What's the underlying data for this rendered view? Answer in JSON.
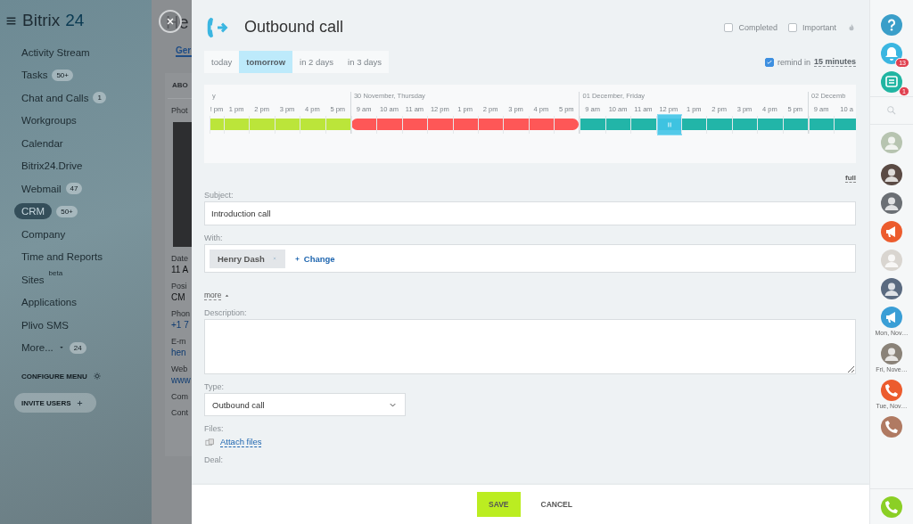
{
  "sidebar": {
    "logo": {
      "name": "Bitrix",
      "number": "24"
    },
    "items": [
      {
        "label": "Activity Stream",
        "selected": false
      },
      {
        "label": "Tasks",
        "counter": "50+",
        "selected": false
      },
      {
        "label": "Chat and Calls",
        "counter": "1",
        "selected": false
      },
      {
        "label": "Workgroups",
        "selected": false
      },
      {
        "label": "Calendar",
        "selected": false
      },
      {
        "label": "Bitrix24.Drive",
        "selected": false
      },
      {
        "label": "Webmail",
        "counter": "47",
        "selected": false
      },
      {
        "label": "CRM",
        "counter": "50+",
        "selected": true
      },
      {
        "label": "Company",
        "selected": false
      },
      {
        "label": "Time and Reports",
        "selected": false
      },
      {
        "label": "Sites",
        "tag": "beta",
        "selected": false
      },
      {
        "label": "Applications",
        "selected": false
      },
      {
        "label": "Plivo SMS",
        "selected": false
      },
      {
        "label": "More...",
        "caret": true,
        "counter": "24",
        "selected": false
      }
    ],
    "configure": "CONFIGURE MENU",
    "invite": "INVITE USERS"
  },
  "contact_card": {
    "title": "He",
    "tab": "Ger",
    "section": "ABO",
    "fields": [
      {
        "label": "Phot",
        "kind": "photo"
      },
      {
        "label": "Date",
        "value": "11 A",
        "kind": "text"
      },
      {
        "label": "Posi",
        "value": "CM",
        "kind": "text"
      },
      {
        "label": "Phon",
        "value": "+1 7",
        "kind": "phone"
      },
      {
        "label": "E-m",
        "value": "hen",
        "kind": "link"
      },
      {
        "label": "Web",
        "value": "www",
        "kind": "link"
      },
      {
        "label": "Com",
        "kind": "text"
      },
      {
        "label": "Cont",
        "kind": "text"
      }
    ]
  },
  "activity": {
    "title": "Outbound call",
    "flags": [
      {
        "label": "Completed",
        "checked": false
      },
      {
        "label": "Important",
        "checked": false
      }
    ],
    "tabs": [
      {
        "label": "today",
        "selected": false
      },
      {
        "label": "tomorrow",
        "selected": true
      },
      {
        "label": "in 2 days",
        "selected": false
      },
      {
        "label": "in 3 days",
        "selected": false
      }
    ],
    "reminder": {
      "checked": true,
      "label": "remind in",
      "value": "15 minutes"
    },
    "timeline": {
      "days": [
        {
          "label": "y",
          "color": "#bbe53a",
          "hours": [
            {
              "label": "! pm",
              "selected": false
            },
            {
              "label": "1 pm",
              "selected": false
            },
            {
              "label": "2 pm",
              "selected": false
            },
            {
              "label": "3 pm",
              "selected": false
            },
            {
              "label": "4 pm",
              "selected": false
            },
            {
              "label": "5 pm",
              "selected": false
            }
          ]
        },
        {
          "label": "30 November, Thursday",
          "color": "#fe5757",
          "hours": [
            {
              "label": "9 am",
              "selected": false
            },
            {
              "label": "10 am",
              "selected": false
            },
            {
              "label": "11 am",
              "selected": false
            },
            {
              "label": "12 pm",
              "selected": false
            },
            {
              "label": "1 pm",
              "selected": false
            },
            {
              "label": "2 pm",
              "selected": false
            },
            {
              "label": "3 pm",
              "selected": false
            },
            {
              "label": "4 pm",
              "selected": false
            },
            {
              "label": "5 pm",
              "selected": false
            }
          ]
        },
        {
          "label": "01 December, Friday",
          "color": "#22b5a8",
          "hours": [
            {
              "label": "9 am",
              "selected": false
            },
            {
              "label": "10 am",
              "selected": false
            },
            {
              "label": "11 am",
              "selected": false
            },
            {
              "label": "12 pm",
              "selected": true
            },
            {
              "label": "1 pm",
              "selected": false
            },
            {
              "label": "2 pm",
              "selected": false
            },
            {
              "label": "3 pm",
              "selected": false
            },
            {
              "label": "4 pm",
              "selected": false
            },
            {
              "label": "5 pm",
              "selected": false
            }
          ]
        },
        {
          "label": "02 Decemb",
          "color": "#22b5a8",
          "hours": [
            {
              "label": "9 am",
              "selected": false
            },
            {
              "label": "10 a",
              "selected": false
            }
          ]
        }
      ],
      "full_link": "full"
    },
    "subject": {
      "label": "Subject:",
      "value": "Introduction call"
    },
    "with": {
      "label": "With:",
      "contact": "Henry Dash",
      "change": "Change"
    },
    "more": "more",
    "description": {
      "label": "Description:"
    },
    "type": {
      "label": "Type:",
      "value": "Outbound call"
    },
    "files": {
      "label": "Files:",
      "link": "Attach files"
    },
    "deal": {
      "label": "Deal:"
    },
    "buttons": [
      {
        "label": "SAVE",
        "kind": "primary"
      },
      {
        "label": "CANCEL",
        "kind": "link"
      }
    ]
  },
  "right_bar": {
    "items": [
      {
        "kind": "help",
        "color": "#3a9ec9"
      },
      {
        "kind": "bell",
        "color": "#3bb6e1",
        "badge": "13"
      },
      {
        "kind": "chat",
        "color": "#21b5a2",
        "badge": "1"
      },
      {
        "kind": "search"
      },
      {
        "kind": "avatar",
        "color": "#b7c4b0"
      },
      {
        "kind": "avatar",
        "color": "#5a4a44"
      },
      {
        "kind": "avatar",
        "color": "#6b6f74"
      },
      {
        "kind": "megaphone",
        "color": "#ec5c2e"
      },
      {
        "kind": "avatar",
        "color": "#d9d5d0"
      },
      {
        "kind": "avatar",
        "color": "#5a6a80"
      },
      {
        "kind": "megaphone",
        "color": "#3a9ed6",
        "caption": "Mon, Nov…"
      },
      {
        "kind": "avatar",
        "color": "#8a8278",
        "caption": "Fri, Nove…"
      },
      {
        "kind": "phone",
        "color": "#ec5c2e",
        "caption": "Tue, Nov…"
      },
      {
        "kind": "phone",
        "color": "#b07a62"
      }
    ],
    "call_button": {
      "color": "#8bcf25"
    }
  }
}
